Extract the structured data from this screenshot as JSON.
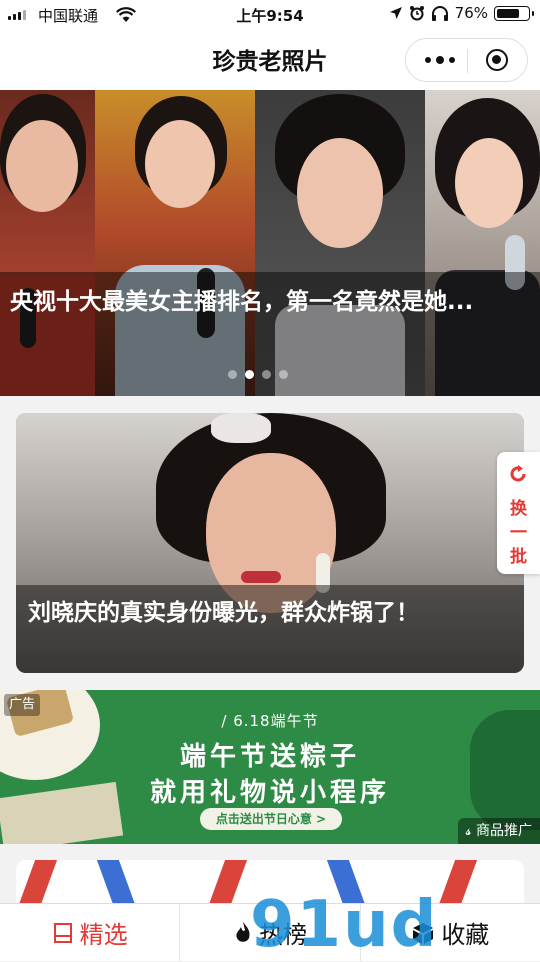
{
  "status_bar": {
    "carrier": "中国联通",
    "time": "上午9:54",
    "battery": "76%",
    "battery_level": 0.76
  },
  "navbar": {
    "title": "珍贵老照片"
  },
  "banner": {
    "title": "央视十大最美女主播排名，第一名竟然是她...",
    "slide_count": 4,
    "active_slide": 1
  },
  "article": {
    "title": "刘晓庆的真实身份曝光，群众炸锅了！"
  },
  "refresh_button": {
    "label_1": "换",
    "label_2": "一",
    "label_3": "批"
  },
  "ad": {
    "tag": "广告",
    "subtitle": "/ 6.18端午节",
    "line1": "端午节送粽子",
    "line2": "就用礼物说小程序",
    "button": "点击送出节日心意 >",
    "promo": "商品推广"
  },
  "tabs": [
    {
      "label": "精选",
      "icon": "shop-icon",
      "active": true
    },
    {
      "label": "热榜",
      "icon": "flame-icon",
      "active": false
    },
    {
      "label": "收藏",
      "icon": "box-icon",
      "active": false
    }
  ],
  "watermark": "91ud",
  "colors": {
    "accent": "#e53935",
    "ad_green": "#2e8b45"
  }
}
